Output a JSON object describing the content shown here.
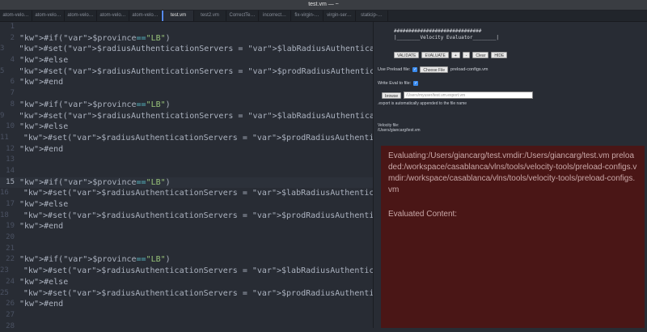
{
  "window": {
    "title": "test.vm — ~"
  },
  "tabs": [
    {
      "label": "atom-velo…",
      "active": false
    },
    {
      "label": "atom-velo…",
      "active": false
    },
    {
      "label": "atom-velo…",
      "active": false
    },
    {
      "label": "atom-velo…",
      "active": false
    },
    {
      "label": "atom-velo…",
      "active": false
    },
    {
      "label": "test.vm",
      "active": true
    },
    {
      "label": "test2.vm",
      "active": false
    },
    {
      "label": "CorrectTe…",
      "active": false
    },
    {
      "label": "incorrect…",
      "active": false
    },
    {
      "label": "fix-virgin-…",
      "active": false
    },
    {
      "label": "virgin-ser…",
      "active": false
    },
    {
      "label": "staticip-…",
      "active": false
    }
  ],
  "editor": {
    "current_line": 15,
    "lines": [
      {
        "n": "1",
        "t": ""
      },
      {
        "n": "2",
        "t": "#if($province==\"LB\")"
      },
      {
        "n": "3",
        "t": "  #set($radiusAuthenticationServers = $labRadiusAuthenticationServers)"
      },
      {
        "n": "4",
        "t": "#else"
      },
      {
        "n": "5",
        "t": "  #set($radiusAuthenticationServers = $prodRadiusAuthenticationServers)"
      },
      {
        "n": "6",
        "t": "#end"
      },
      {
        "n": "7",
        "t": ""
      },
      {
        "n": "8",
        "t": "#if($province==\"LB\")"
      },
      {
        "n": "9",
        "t": "  #set($radiusAuthenticationServers = $labRadiusAuthenticationServers)"
      },
      {
        "n": "10",
        "t": "#else"
      },
      {
        "n": "11",
        "t": "  #set($radiusAuthenticationServers = $prodRadiusAuthenticationServers)"
      },
      {
        "n": "12",
        "t": "#end"
      },
      {
        "n": "13",
        "t": ""
      },
      {
        "n": "14",
        "t": ""
      },
      {
        "n": "15",
        "t": "#if($province==\"LB\")"
      },
      {
        "n": "16",
        "t": "  #set($radiusAuthenticationServers = $labRadiusAuthenticationServers)"
      },
      {
        "n": "17",
        "t": "#else"
      },
      {
        "n": "18",
        "t": "  #set($radiusAuthenticationServers = $prodRadiusAuthenticationServers)"
      },
      {
        "n": "19",
        "t": "#end"
      },
      {
        "n": "20",
        "t": ""
      },
      {
        "n": "21",
        "t": ""
      },
      {
        "n": "22",
        "t": "#if($province==\"LB\")"
      },
      {
        "n": "23",
        "t": "  #set($radiusAuthenticationServers = $labRadiusAuthenticationServers)"
      },
      {
        "n": "24",
        "t": "#else"
      },
      {
        "n": "25",
        "t": "  #set($radiusAuthenticationServers = $prodRadiusAuthenticationServers)"
      },
      {
        "n": "26",
        "t": "#end"
      },
      {
        "n": "27",
        "t": ""
      },
      {
        "n": "28",
        "t": ""
      }
    ]
  },
  "panel": {
    "banner_line1": "##############################",
    "banner_line2": "|________Velocity Evaluator________|",
    "buttons": [
      "VALIDATE",
      "EVALUATE",
      "+",
      "-",
      "Clear",
      "HIDE"
    ],
    "use_preload_label": "Use Preload file:",
    "choose_file_label": "Choose File",
    "preload_file": "preload-configs.vm",
    "write_eval_label": "Write Eval to file:",
    "browse_label": "browse",
    "path_placeholder": "/Users/myuser/test.vm.export.vm",
    "export_note": ".export is automatically appended to the file name",
    "velocity_file_label": "Velocity file:",
    "velocity_file_path": "/Users/giancarg/test.vm",
    "result_text": "Evaluating:/Users/giancarg/test.vmdir:/Users/giancarg/test.vm preloaded:/workspace/casablanca/vlns/tools/velocity-tools/preload-configs.vmdir:/workspace/casablanca/vlns/tools/velocity-tools/preload-configs.vm",
    "evaluated_label": "Evaluated Content:"
  }
}
